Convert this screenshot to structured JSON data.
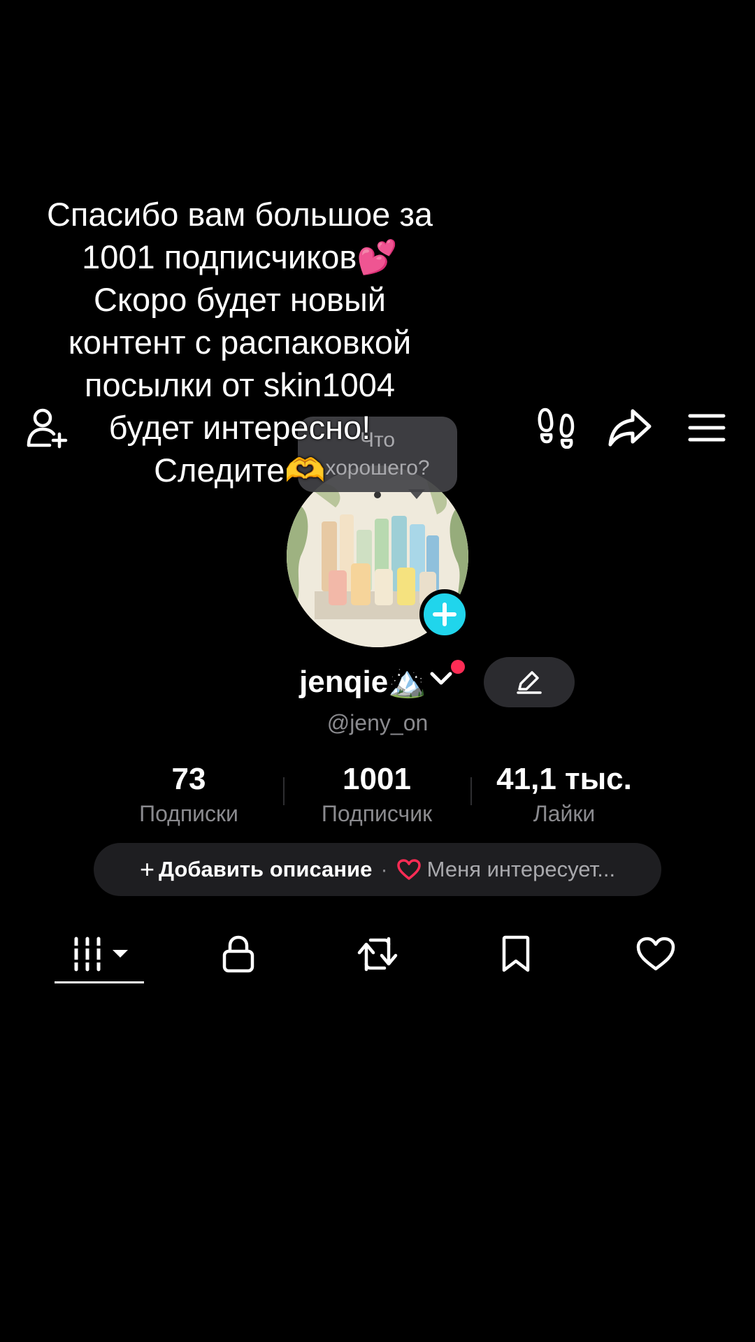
{
  "overlay": {
    "caption": "Спасибо вам большое за\n1001 подписчиков💕\nСкоро будет новый\nконтент с распаковкой\nпосылки от skin1004\nбудет интересно!\nСледите🫶"
  },
  "header": {
    "add_friend_icon": "add-user-icon",
    "footprints_icon": "footprints-icon",
    "share_icon": "share-icon",
    "menu_icon": "menu-icon"
  },
  "bubble": {
    "text": "Что\nхорошего?"
  },
  "profile": {
    "username": "jenqie🏔️",
    "handle": "@jeny_on"
  },
  "stats": [
    {
      "value": "73",
      "label": "Подписки"
    },
    {
      "value": "1001",
      "label": "Подписчик"
    },
    {
      "value": "41,1 тыс.",
      "label": "Лайки"
    }
  ],
  "bio": {
    "plus": "+",
    "add_label": "Добавить описание",
    "separator": "·",
    "interest_label": "Меня интересует..."
  },
  "tabs": [
    {
      "name": "videos",
      "icon": "grid-icon",
      "active": true
    },
    {
      "name": "private",
      "icon": "lock-icon"
    },
    {
      "name": "reposts",
      "icon": "repost-icon"
    },
    {
      "name": "favorites",
      "icon": "bookmark-icon"
    },
    {
      "name": "liked",
      "icon": "heart-icon"
    }
  ],
  "colors": {
    "background": "#000000",
    "accent_cyan": "#20d5ec",
    "notification_red": "#fe2c55",
    "muted_text": "#8a8a8e",
    "heart_pink": "#fe2c55"
  }
}
